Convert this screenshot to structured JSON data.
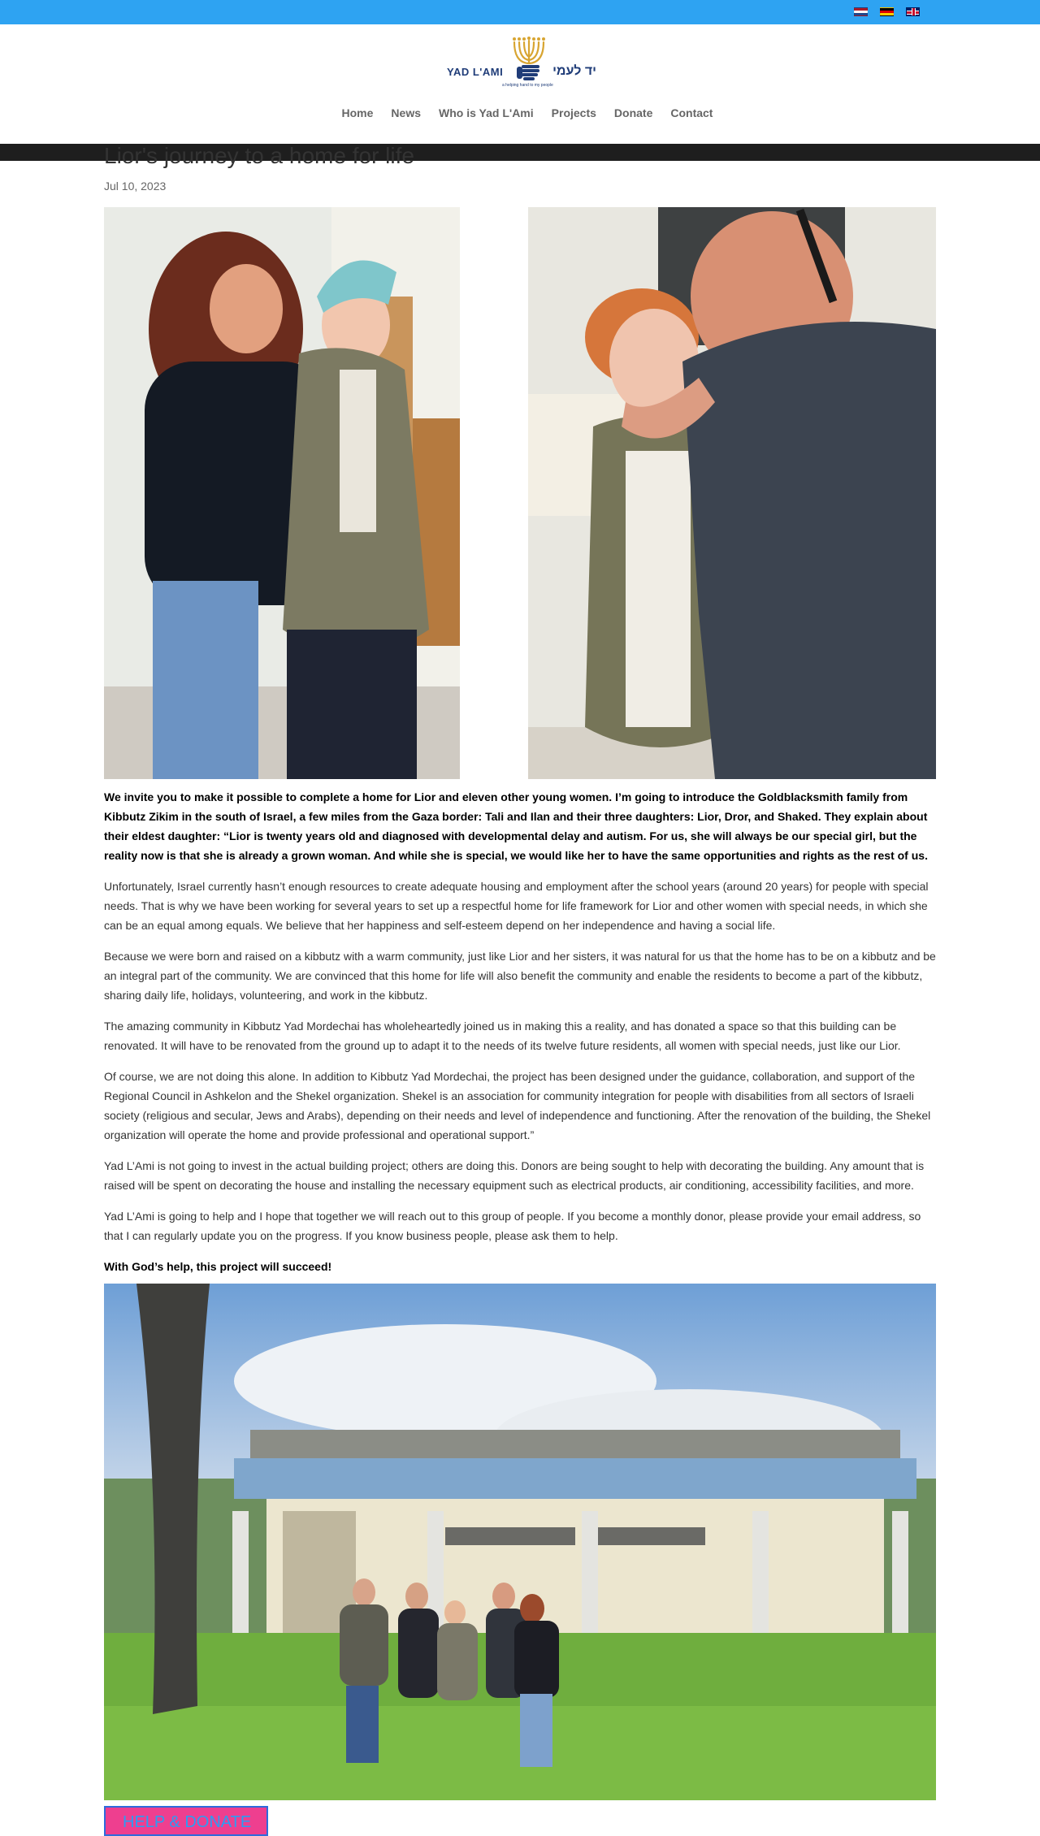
{
  "languages": [
    {
      "code": "NL",
      "icon": "flag-netherlands-icon"
    },
    {
      "code": "DE",
      "icon": "flag-germany-icon"
    },
    {
      "code": "EN",
      "icon": "flag-uk-icon"
    }
  ],
  "logo": {
    "name_en": "YAD L'AMI",
    "name_he": "יד לעמי",
    "tagline": "a helping hand to my people",
    "icon": "menorah-hand-logo"
  },
  "nav": {
    "items": [
      "Home",
      "News",
      "Who is Yad L'Ami",
      "Projects",
      "Donate",
      "Contact"
    ]
  },
  "post": {
    "title": "Lior's journey to a home for life",
    "date": "Jul 10, 2023",
    "paragraphs": [
      {
        "bold": true,
        "text": "We invite you to make it possible to complete a home for Lior and eleven other young women. I’m going to introduce the Goldblacksmith family from Kibbutz Zikim in the south of Israel, a few miles from the Gaza border: Tali and Ilan and their three daughters: Lior, Dror, and Shaked. They explain about their eldest daughter: “Lior is twenty years old and diagnosed with developmental delay and autism. For us, she will always be our special girl, but the reality now is that she is already a grown woman. And while she is special, we would like her to have the same opportunities and rights as the rest of us."
      },
      {
        "bold": false,
        "text": "Unfortunately, Israel currently hasn’t enough resources to create adequate housing and employment after the school years (around 20 years) for people with special needs. That is why we have been working for several years to set up a respectful home for life framework for Lior and other women with special needs, in which she can be an equal among equals. We believe that her happiness and self-esteem depend on her independence and having a social life."
      },
      {
        "bold": false,
        "text": "Because we were born and raised on a kibbutz with a warm community, just like Lior and her sisters, it was natural for us that the home has to be on a kibbutz and be an integral part of the community. We are convinced that this home for life will also benefit the community and enable the residents to become a part of the kibbutz, sharing daily life, holidays, volunteering, and work in the kibbutz."
      },
      {
        "bold": false,
        "text": "The amazing community in Kibbutz Yad Mordechai has wholeheartedly joined us in making this a reality, and has donated a space so that this building can be renovated. It will have to be renovated from the ground up to adapt it to the needs of its twelve future residents, all women with special needs, just like our Lior."
      },
      {
        "bold": false,
        "text": "Of course, we are not doing this alone. In addition to Kibbutz Yad Mordechai, the project has been designed under the guidance, collaboration, and support of the Regional Council in Ashkelon and the Shekel organization. Shekel is an association for community integration for people with disabilities from all sectors of Israeli society (religious and secular, Jews and Arabs), depending on their needs and level of independence and functioning. After the renovation of the building, the Shekel organization will operate the home and provide professional and operational support.”"
      },
      {
        "bold": false,
        "text": "Yad L’Ami is not going to invest in the actual building project; others are doing this. Donors are being sought to help with decorating the building. Any amount that is raised will be spent on decorating the house and installing the necessary equipment such as electrical products, air conditioning, accessibility facilities, and more."
      },
      {
        "bold": false,
        "text": "Yad L’Ami is going to help and I hope that together we will reach out to this group of people. If you become a monthly donor, please provide your email address, so that I can regularly update you on the progress. If you know business people, please ask them to help."
      },
      {
        "bold": true,
        "text": "With God’s help, this project will succeed!"
      }
    ],
    "photos": [
      {
        "name": "photo-mother-hugging-lior"
      },
      {
        "name": "photo-father-with-lior"
      },
      {
        "name": "photo-family-in-front-of-building"
      }
    ],
    "donate_label": "HELP & DONATE"
  },
  "colors": {
    "topbar": "#2ea3f2",
    "button_bg": "#ee3f8f",
    "button_text": "#2a9df4",
    "logo_blue": "#1f3c78",
    "logo_gold": "#d8a532"
  }
}
